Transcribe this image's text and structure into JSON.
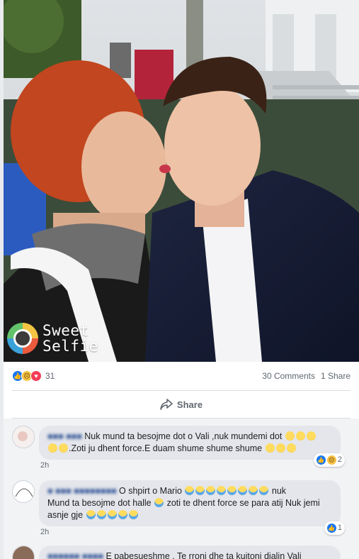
{
  "photo": {
    "watermark_line1": "Sweet",
    "watermark_line2": "Selfie",
    "watermark_icon": "camera-lens-icon"
  },
  "stats": {
    "reaction_count": "31",
    "comments": "30 Comments",
    "shares": "1 Share",
    "reaction_icons": [
      "like-icon",
      "sad-icon",
      "love-icon"
    ]
  },
  "actions": {
    "share_label": "Share"
  },
  "comments": [
    {
      "text_a": " Nuk mund ta besojme dot o Vali ,nuk mundemi dot ",
      "text_b": ".Zoti ju dhent force.E duam shume shume shume ",
      "time": "2h",
      "reactions": "2"
    },
    {
      "text_a": " O shpirt o Mario ",
      "text_b": " nuk",
      "text_c": "Mund ta besojme dot halle ",
      "text_d": " zoti te dhent force se para atij Nuk jemi",
      "text_e": "asnje gje ",
      "time": "2h",
      "reactions": "1"
    },
    {
      "text_a": " E pabesueshme . Te rroni dhe ta kujtoni djalin Vali"
    }
  ],
  "colors": {
    "link": "#385898",
    "like": "#1877f2",
    "love": "#f33e58",
    "sad": "#f7c244"
  }
}
